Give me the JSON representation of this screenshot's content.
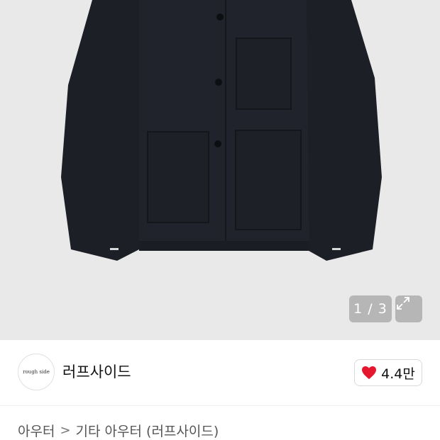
{
  "gallery": {
    "counter": "1 / 3",
    "icons": {
      "expand": "expand-icon"
    }
  },
  "seller": {
    "logo_text": "rough side",
    "name": "러프사이드"
  },
  "like": {
    "count": "4.4만",
    "icon": "heart-icon",
    "color": "#e5172f"
  },
  "breadcrumb": {
    "level1": "아우터",
    "separator": ">",
    "level2": "기타 아우터 (러프사이드)"
  }
}
